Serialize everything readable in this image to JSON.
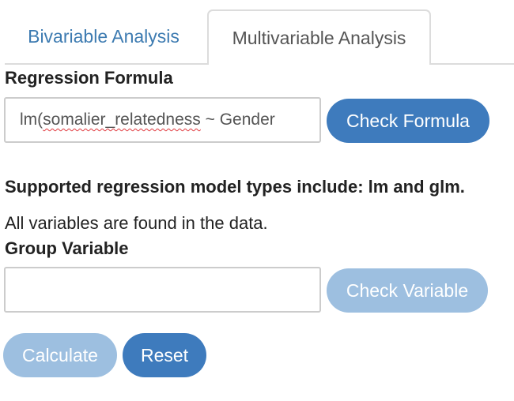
{
  "tabs": {
    "bivariable": "Bivariable Analysis",
    "multivariable": "Multivariable Analysis"
  },
  "regression": {
    "label": "Regression Formula",
    "formula_prefix": "lm(",
    "formula_misspelled": "somalier_relatedness",
    "formula_rest": " ~ Gender",
    "check_button": "Check Formula"
  },
  "notes": {
    "supported_types": "Supported regression model types include: lm and glm.",
    "variables_found": "All variables are found in the data."
  },
  "group": {
    "label": "Group Variable",
    "value": "",
    "check_button": "Check Variable"
  },
  "actions": {
    "calculate": "Calculate",
    "reset": "Reset"
  },
  "colors": {
    "primary": "#3e7bbd",
    "disabled": "#9dbfe0",
    "tab_link": "#3d7bb1",
    "misspell_underline": "#e0393e"
  }
}
